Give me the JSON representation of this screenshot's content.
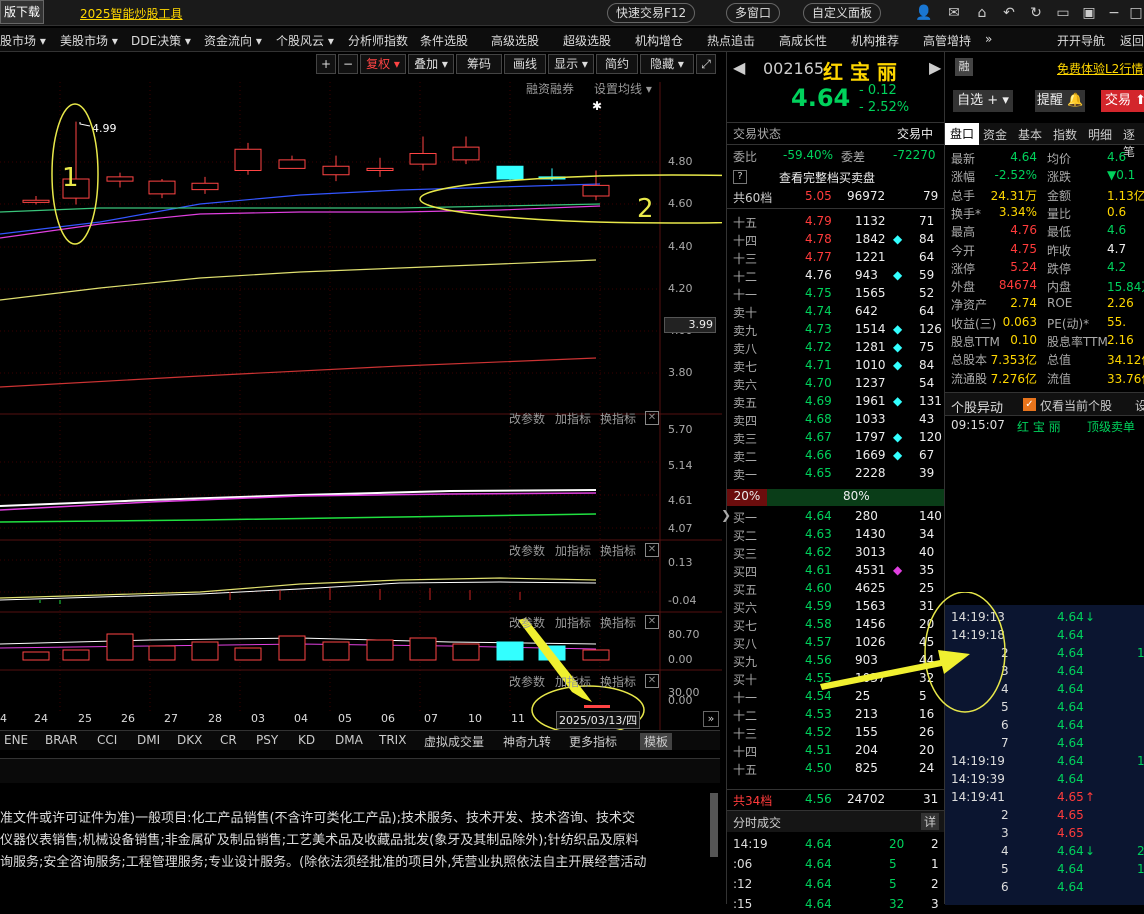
{
  "titlebar": {
    "left_text": "版下载",
    "promo": "2025智能炒股工具",
    "quick_trade": "快速交易F12",
    "multi_window": "多窗口",
    "custom_panel": "自定义面板"
  },
  "menu": [
    "股市场 ▾",
    "美股市场 ▾",
    "DDE决策 ▾",
    "资金流向 ▾",
    "个股风云 ▾",
    "分析师指数",
    "条件选股",
    "高级选股",
    "超级选股",
    "机构增仓",
    "热点追击",
    "高成长性",
    "机构推荐",
    "高管增持",
    "»",
    "开开导航",
    "返回"
  ],
  "chart_toolbar": {
    "plus": "+",
    "minus": "−",
    "fuquan": "复权 ▾",
    "diejia": "叠加 ▾",
    "chouma": "筹码",
    "huaxian": "画线",
    "xianshi": "显示 ▾",
    "jianyue": "简约",
    "yincang": "隐藏 ▾",
    "expand": "⤢"
  },
  "chart_top": {
    "rongzi": "融资融券",
    "junxian": "设置均线 ▾",
    "high_label": "4.99"
  },
  "yaxis_main": [
    "4.80",
    "4.60",
    "4.40",
    "4.20",
    "4.00",
    "3.80"
  ],
  "price_box": "3.99",
  "yaxis_p2": [
    "5.70",
    "5.14",
    "4.61",
    "4.07"
  ],
  "yaxis_p3": [
    "0.13",
    "-0.04"
  ],
  "yaxis_p4": [
    "80.70",
    "0.00"
  ],
  "yaxis_p5": [
    "30.00",
    "0.00"
  ],
  "panel_hdr": {
    "gai": "改参数",
    "jia": "加指标",
    "huan": "换指标",
    "x": "✕"
  },
  "xaxis": [
    "4",
    "24",
    "25",
    "26",
    "27",
    "28",
    "03",
    "04",
    "05",
    "06",
    "07",
    "10",
    "11"
  ],
  "date_box": "2025/03/13/四",
  "annotations": {
    "one": "1",
    "two": "2"
  },
  "chart_data": {
    "type": "candlestick",
    "categories": [
      "24",
      "25",
      "26",
      "27",
      "28",
      "03",
      "04",
      "05",
      "06",
      "07",
      "10",
      "11",
      "12",
      "13"
    ],
    "open": [
      4.61,
      4.63,
      4.71,
      4.65,
      4.67,
      4.76,
      4.77,
      4.74,
      4.76,
      4.79,
      4.81,
      4.78,
      4.73,
      4.64
    ],
    "close": [
      4.62,
      4.72,
      4.73,
      4.71,
      4.7,
      4.86,
      4.81,
      4.78,
      4.77,
      4.84,
      4.87,
      4.72,
      4.72,
      4.69
    ],
    "high": [
      4.64,
      4.99,
      4.75,
      4.72,
      4.73,
      4.89,
      4.83,
      4.83,
      4.82,
      4.92,
      4.92,
      4.78,
      4.77,
      4.76
    ],
    "low": [
      4.6,
      4.6,
      4.68,
      4.63,
      4.65,
      4.74,
      4.77,
      4.71,
      4.73,
      4.76,
      4.79,
      4.71,
      4.71,
      4.62
    ],
    "ylim": [
      3.7,
      5.0
    ]
  },
  "itabs": [
    "ENE",
    "BRAR",
    "CCI",
    "DMI",
    "DKX",
    "CR",
    "PSY",
    "KD",
    "DMA",
    "TRIX",
    "虚拟成交量",
    "神奇九转",
    "更多指标",
    "模板"
  ],
  "info_lines": [
    "准文件或许可证件为准)一般项目:化工产品销售(不含许可类化工产品);技术服务、技术开发、技术咨询、技术交",
    "仪器仪表销售;机械设备销售;非金属矿及制品销售;工艺美术品及收藏品批发(象牙及其制品除外);针纺织品及原料",
    "询服务;安全咨询服务;工程管理服务;专业设计服务。(除依法须经批准的项目外,凭营业执照依法自主开展经营活动"
  ],
  "stock": {
    "code": "002165",
    "name": "红 宝 丽",
    "price": "4.64",
    "change": "- 0.12",
    "pct": "- 2.52%",
    "rong": "融"
  },
  "status": {
    "label": "交易状态",
    "value": "交易中"
  },
  "weibi": {
    "label": "委比",
    "value": "-59.40%",
    "label2": "委差",
    "value2": "-72270"
  },
  "view_full": "查看完整档买卖盘",
  "sell_total": {
    "label": "共60档",
    "price": "5.05",
    "vol": "96972",
    "n": "79"
  },
  "asks": [
    [
      "十五",
      "4.79",
      "1132",
      "",
      "71"
    ],
    [
      "十四",
      "4.78",
      "1842",
      "◆",
      "84"
    ],
    [
      "十三",
      "4.77",
      "1221",
      "",
      "64"
    ],
    [
      "十二",
      "4.76",
      "943",
      "◆",
      "59"
    ],
    [
      "十一",
      "4.75",
      "1565",
      "",
      "52"
    ],
    [
      "卖十",
      "4.74",
      "642",
      "",
      "64"
    ],
    [
      "卖九",
      "4.73",
      "1514",
      "◆",
      "126"
    ],
    [
      "卖八",
      "4.72",
      "1281",
      "◆",
      "75"
    ],
    [
      "卖七",
      "4.71",
      "1010",
      "◆",
      "84"
    ],
    [
      "卖六",
      "4.70",
      "1237",
      "",
      "54"
    ],
    [
      "卖五",
      "4.69",
      "1961",
      "◆",
      "131"
    ],
    [
      "卖四",
      "4.68",
      "1033",
      "",
      "43"
    ],
    [
      "卖三",
      "4.67",
      "1797",
      "◆",
      "120"
    ],
    [
      "卖二",
      "4.66",
      "1669",
      "◆",
      "67"
    ],
    [
      "卖一",
      "4.65",
      "2228",
      "",
      "39"
    ]
  ],
  "ratio": {
    "left": "20%",
    "right": "80%"
  },
  "bids": [
    [
      "买一",
      "4.64",
      "280",
      "",
      "140"
    ],
    [
      "买二",
      "4.63",
      "1430",
      "",
      "34"
    ],
    [
      "买三",
      "4.62",
      "3013",
      "",
      "40"
    ],
    [
      "买四",
      "4.61",
      "4531",
      "◆",
      "35"
    ],
    [
      "买五",
      "4.60",
      "4625",
      "",
      "25"
    ],
    [
      "买六",
      "4.59",
      "1563",
      "",
      "31"
    ],
    [
      "买七",
      "4.58",
      "1456",
      "",
      "20"
    ],
    [
      "买八",
      "4.57",
      "1026",
      "",
      "45"
    ],
    [
      "买九",
      "4.56",
      "903",
      "",
      "44"
    ],
    [
      "买十",
      "4.55",
      "1037",
      "",
      "32"
    ],
    [
      "十一",
      "4.54",
      "25",
      "",
      "5"
    ],
    [
      "十二",
      "4.53",
      "213",
      "",
      "16"
    ],
    [
      "十三",
      "4.52",
      "155",
      "",
      "26"
    ],
    [
      "十四",
      "4.51",
      "204",
      "",
      "20"
    ],
    [
      "十五",
      "4.50",
      "825",
      "",
      "24"
    ]
  ],
  "buy_total": {
    "label": "共34档",
    "price": "4.56",
    "vol": "24702",
    "n": "31"
  },
  "fenshi": {
    "label": "分时成交",
    "detail": "详",
    "rows": [
      [
        "14:19",
        "4.64",
        "20",
        "2"
      ],
      [
        ":06",
        "4.64",
        "5",
        "1"
      ],
      [
        ":12",
        "4.64",
        "5",
        "2"
      ],
      [
        ":15",
        "4.64",
        "32",
        "3"
      ]
    ]
  },
  "right_top": {
    "rong": "融",
    "promo": "免费体验L2行情",
    "zixuan": "自选 + ▾",
    "tixing": "提醒 🔔",
    "jiaoyi": "交易 ⬆⬇"
  },
  "rtabs": [
    "盘口",
    "资金",
    "基本",
    "指数",
    "明细",
    "逐笔"
  ],
  "stats": [
    [
      "最新",
      "4.64",
      "均价",
      "4.6"
    ],
    [
      "涨幅",
      "-2.52%",
      "涨跌",
      "▼0.1"
    ],
    [
      "总手",
      "24.31万",
      "金额",
      "1.13亿"
    ],
    [
      "换手*",
      "3.34%",
      "量比",
      "0.6"
    ],
    [
      "最高",
      "4.76",
      "最低",
      "4.6"
    ],
    [
      "今开",
      "4.75",
      "昨收",
      "4.7"
    ],
    [
      "涨停",
      "5.24",
      "跌停",
      "4.2"
    ],
    [
      "外盘",
      "84674",
      "内盘",
      "15.84万"
    ],
    [
      "净资产",
      "2.74",
      "ROE",
      "2.26"
    ],
    [
      "收益(三)",
      "0.063",
      "PE(动)*",
      "55."
    ],
    [
      "股息TTM",
      "0.10",
      "股息率TTM",
      "2.16"
    ],
    [
      "总股本",
      "7.353亿",
      "总值",
      "34.12亿"
    ],
    [
      "流通股",
      "7.276亿",
      "流值",
      "33.76亿"
    ]
  ],
  "yidong": {
    "label": "个股异动",
    "checkbox": "仅看当前个股",
    "setting": "设",
    "time": "09:15:07",
    "name": "红 宝 丽",
    "event": "顶级卖单"
  },
  "ticks": [
    [
      "14:19:13",
      "4.64",
      "↓",
      ""
    ],
    [
      "14:19:18",
      "4.64",
      "",
      ""
    ],
    [
      "2",
      "4.64",
      "",
      "1"
    ],
    [
      "3",
      "4.64",
      "",
      ""
    ],
    [
      "4",
      "4.64",
      "",
      ""
    ],
    [
      "5",
      "4.64",
      "",
      ""
    ],
    [
      "6",
      "4.64",
      "",
      ""
    ],
    [
      "7",
      "4.64",
      "",
      ""
    ],
    [
      "14:19:19",
      "4.64",
      "",
      "1"
    ],
    [
      "14:19:39",
      "4.64",
      "",
      ""
    ],
    [
      "14:19:41",
      "4.65",
      "↑",
      ""
    ],
    [
      "2",
      "4.65",
      "",
      ""
    ],
    [
      "3",
      "4.65",
      "",
      ""
    ],
    [
      "4",
      "4.64",
      "↓",
      "2"
    ],
    [
      "5",
      "4.64",
      "",
      "1"
    ],
    [
      "6",
      "4.64",
      "",
      ""
    ]
  ]
}
